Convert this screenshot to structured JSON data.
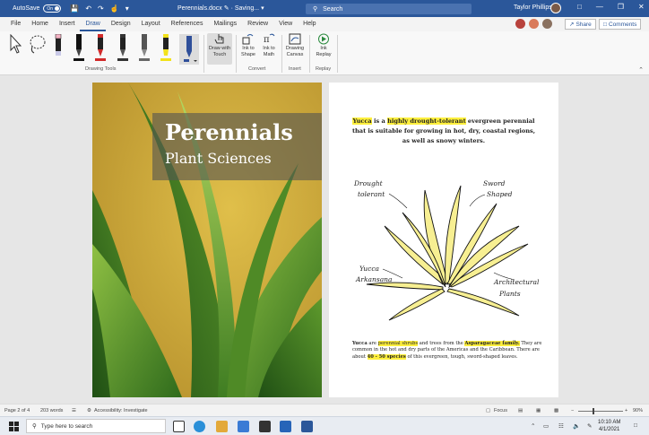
{
  "titlebar": {
    "autosave_label": "AutoSave",
    "autosave_state": "On",
    "doc_title": "Perennials.docx",
    "saving_status": "Saving...",
    "search_placeholder": "Search",
    "user_name": "Taylor Phillips"
  },
  "menu": {
    "tabs": [
      "File",
      "Home",
      "Insert",
      "Draw",
      "Design",
      "Layout",
      "References",
      "Mailings",
      "Review",
      "View",
      "Help"
    ],
    "active": "Draw",
    "share": "Share",
    "comments": "Comments"
  },
  "ribbon": {
    "drawing_tools_label": "Drawing Tools",
    "draw_with_touch": [
      "Draw with",
      "Touch"
    ],
    "ink_to_shape": [
      "Ink to",
      "Shape"
    ],
    "ink_to_math": [
      "Ink to",
      "Math"
    ],
    "convert_label": "Convert",
    "drawing_canvas": [
      "Drawing",
      "Canvas"
    ],
    "insert_label": "Insert",
    "ink_replay": [
      "Ink",
      "Replay"
    ],
    "replay_label": "Replay",
    "pen_colors": [
      "#111111",
      "#d12a2a",
      "#333333",
      "#555555",
      "#f2e21a",
      "#2f4f9a"
    ]
  },
  "cover": {
    "title": "Perennials",
    "subtitle": "Plant Sciences"
  },
  "page2": {
    "intro": {
      "p1": "Yucca",
      "p2": " is a ",
      "p3": "highly drought-tolerant",
      "p4": " evergreen perennial that is suitable for growing in hot, dry, coastal regions, as well as snowy winters."
    },
    "annotations": {
      "drought1": "Drought",
      "drought2": "tolerant",
      "sword1": "Sword",
      "sword2": "Shaped",
      "yucca1": "Yucca",
      "yucca2": "Arkansana",
      "arch1": "Architectural",
      "arch2": "Plants"
    },
    "bottom": {
      "b1": "Yucca",
      "b2": " are ",
      "b3": "perennial shrubs",
      "b4": " and trees from the ",
      "b5": "Asparagaceae family.",
      "b6": " They are common in the hot and dry parts of the Americas and the Caribbean. There are about ",
      "b7": "40 - 50 species",
      "b8": " of this evergreen, tough, sword-shaped leaves."
    }
  },
  "status": {
    "page": "Page 2 of 4",
    "words": "203 words",
    "accessibility": "Accessibility: Investigate",
    "focus": "Focus",
    "zoom": "90%"
  },
  "taskbar": {
    "search_placeholder": "Type here to search",
    "time": "10:10 AM",
    "date": "4/1/2021"
  }
}
